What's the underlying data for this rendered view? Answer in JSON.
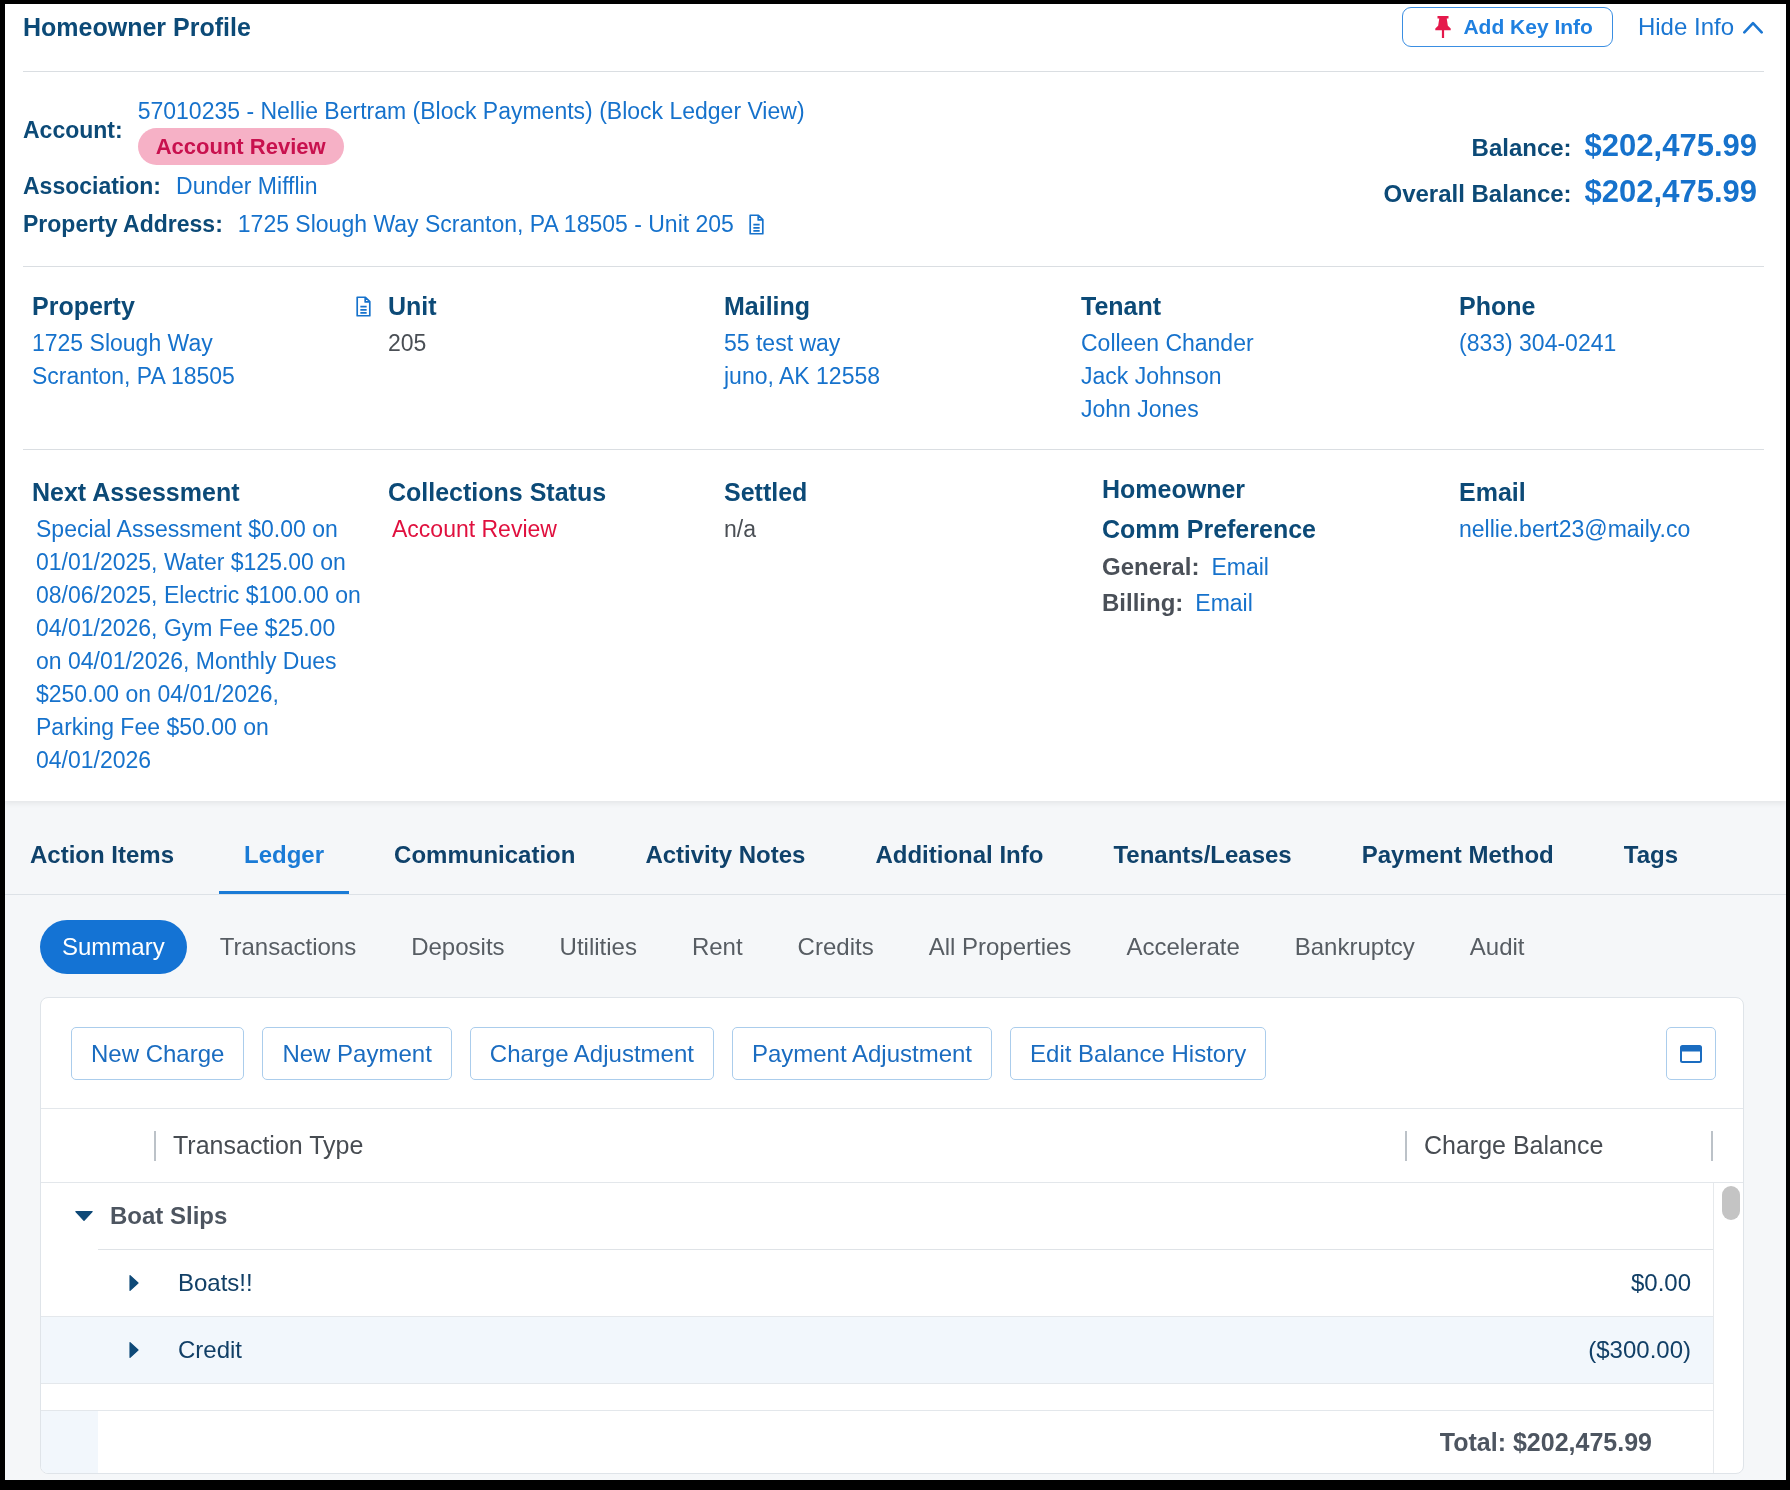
{
  "header": {
    "title": "Homeowner Profile",
    "key_info_button": "Add Key Info",
    "toggle_link": "Hide Info",
    "expanded": true
  },
  "summary": {
    "fields": [
      {
        "label": "Account:",
        "value": "57010235 - Nellie Bertram (Block Payments) (Block Ledger View)",
        "badge": "Account Review",
        "document_icon": false
      },
      {
        "label": "Association:",
        "value": "Dunder Mifflin",
        "document_icon": false
      },
      {
        "label": "Property Address:",
        "value": "1725 Slough Way Scranton, PA 18505 - Unit 205",
        "document_icon": true
      }
    ],
    "balances": [
      {
        "label": "Balance:",
        "value": "$202,475.99"
      },
      {
        "label": "Overall Balance:",
        "value": "$202,475.99"
      }
    ]
  },
  "detail_rows": [
    {
      "fields": [
        {
          "kind": "link",
          "heading": "Property",
          "lines": [
            "1725 Slough Way",
            "Scranton, PA 18505"
          ],
          "document_icon": true
        },
        {
          "kind": "plain",
          "heading": "Unit",
          "lines": [
            "205"
          ],
          "document_icon": false
        },
        {
          "kind": "link",
          "heading": "Mailing",
          "lines": [
            "55 test way",
            "juno, AK 12558"
          ],
          "document_icon": false
        },
        {
          "kind": "link",
          "heading": "Tenant",
          "lines": [
            "Colleen Chander",
            "Jack Johnson",
            "John Jones"
          ],
          "document_icon": false
        },
        {
          "kind": "link",
          "heading": "Phone",
          "lines": [
            "(833) 304-0241"
          ],
          "document_icon": false
        }
      ]
    },
    {
      "fields": [
        {
          "kind": "note",
          "heading": "Next Assessment",
          "lines": [
            "Special Assessment $0.00 on 01/01/2025, Water $125.00 on 08/06/2025, Electric $100.00 on 04/01/2026, Gym Fee $25.00 on 04/01/2026, Monthly Dues $250.00 on 04/01/2026, Parking Fee $50.00 on 04/01/2026"
          ],
          "document_icon": false
        },
        {
          "kind": "alert",
          "heading": "Collections Status",
          "lines": [
            "Account Review"
          ],
          "document_icon": false
        },
        {
          "kind": "plain",
          "heading": "Settled",
          "lines": [
            "n/a"
          ],
          "document_icon": false
        },
        {
          "kind": "preferences",
          "heading": "Homeowner Comm Preference",
          "preferences": [
            {
              "label": "General:",
              "value": "Email"
            },
            {
              "label": "Billing:",
              "value": "Email"
            }
          ],
          "document_icon": false
        },
        {
          "kind": "link",
          "heading": "Email",
          "lines": [
            "nellie.bert23@maily.co"
          ],
          "document_icon": false
        }
      ]
    }
  ],
  "tabs": [
    {
      "label": "Action Items",
      "selected": false
    },
    {
      "label": "Ledger",
      "selected": true
    },
    {
      "label": "Communication",
      "selected": false
    },
    {
      "label": "Activity Notes",
      "selected": false
    },
    {
      "label": "Additional Info",
      "selected": false
    },
    {
      "label": "Tenants/Leases",
      "selected": false
    },
    {
      "label": "Payment Method",
      "selected": false
    },
    {
      "label": "Tags",
      "selected": false
    }
  ],
  "subtabs": [
    {
      "label": "Summary",
      "selected": true
    },
    {
      "label": "Transactions",
      "selected": false
    },
    {
      "label": "Deposits",
      "selected": false
    },
    {
      "label": "Utilities",
      "selected": false
    },
    {
      "label": "Rent",
      "selected": false
    },
    {
      "label": "Credits",
      "selected": false
    },
    {
      "label": "All Properties",
      "selected": false
    },
    {
      "label": "Accelerate",
      "selected": false
    },
    {
      "label": "Bankruptcy",
      "selected": false
    },
    {
      "label": "Audit",
      "selected": false
    }
  ],
  "ledger": {
    "actions": [
      "New Charge",
      "New Payment",
      "Charge Adjustment",
      "Payment Adjustment",
      "Edit Balance History"
    ],
    "table": {
      "columns": [
        "Transaction Type",
        "Charge Balance"
      ],
      "groups": [
        {
          "label": "Boat Slips",
          "expanded": true,
          "rows": [
            {
              "label": "Boats!!",
              "value": "$0.00",
              "expanded": false,
              "selected": false
            },
            {
              "label": "Credit",
              "value": "($300.00)",
              "expanded": false,
              "selected": true
            }
          ]
        }
      ],
      "total": "Total: $202,475.99"
    }
  }
}
